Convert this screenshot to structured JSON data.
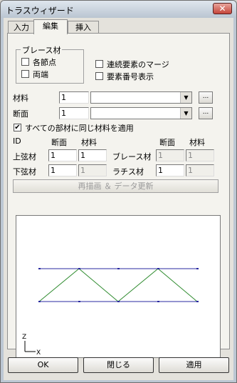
{
  "window": {
    "title": "トラスウィザード",
    "close_glyph": "✕"
  },
  "tabs": [
    "入力",
    "編集",
    "挿入"
  ],
  "brace_group": {
    "label": "ブレース材",
    "options": [
      {
        "label": "各節点",
        "checked": false
      },
      {
        "label": "両端",
        "checked": false
      }
    ]
  },
  "options": [
    {
      "label": "連続要素のマージ",
      "checked": false
    },
    {
      "label": "要素番号表示",
      "checked": false
    }
  ],
  "material": {
    "label": "材料",
    "value": "1",
    "combo_value": "",
    "browse_label": "..."
  },
  "section": {
    "label": "断面",
    "value": "1",
    "combo_value": "",
    "browse_label": "..."
  },
  "apply_all": {
    "label": "すべての部材に同じ材料を適用",
    "checked": true
  },
  "grid": {
    "headers": {
      "id": "ID",
      "section": "断面",
      "material": "材料"
    },
    "top_chord": {
      "label": "上弦材",
      "section": "1",
      "material": "1"
    },
    "bottom_chord": {
      "label": "下弦材",
      "section": "1",
      "material": "1"
    },
    "brace": {
      "label": "ブレース材",
      "section": "1",
      "material": "1"
    },
    "lattice": {
      "label": "ラチス材",
      "section": "1",
      "material": "1"
    }
  },
  "redraw_button": "再描画 ＆ データ更新",
  "preview": {
    "axis_z": "Z",
    "axis_x": "X",
    "chord_color": "#2a2aa0",
    "web_color": "#2e8b2e"
  },
  "buttons": {
    "ok": "OK",
    "close": "閉じる",
    "apply": "適用"
  }
}
